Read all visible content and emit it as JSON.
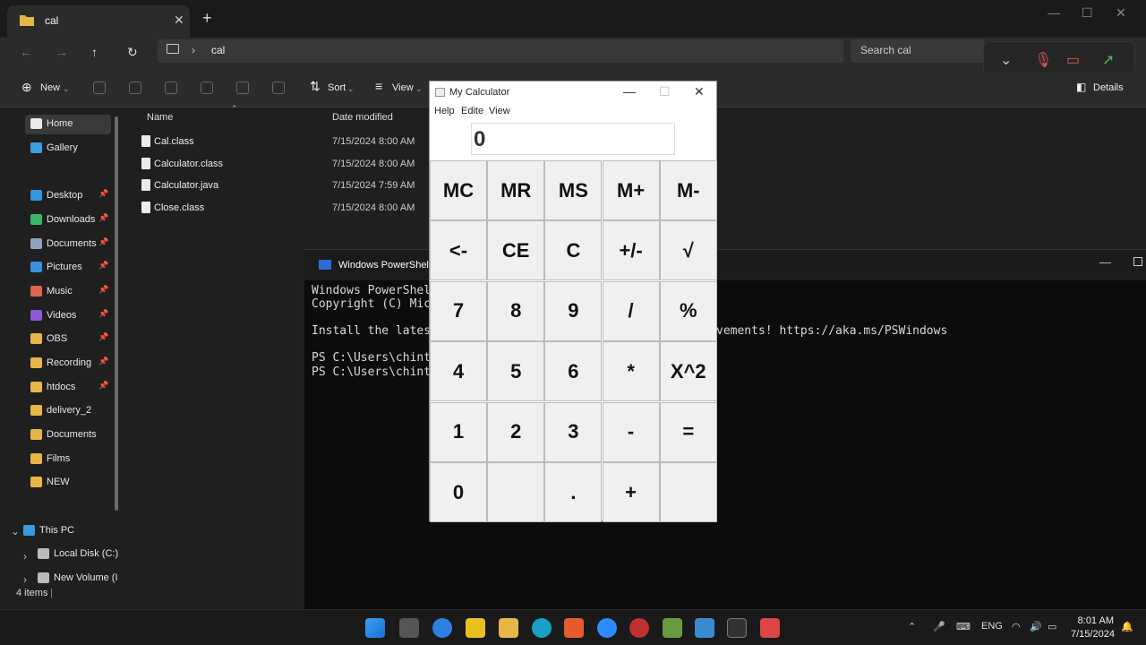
{
  "explorer": {
    "tab_title": "cal",
    "address_path": "cal",
    "search_placeholder": "Search cal",
    "toolbar": {
      "new_label": "New",
      "sort_label": "Sort",
      "view_label": "View",
      "details_label": "Details"
    },
    "columns": {
      "name": "Name",
      "date_modified": "Date modified"
    },
    "files": [
      {
        "name": "Cal.class",
        "date": "7/15/2024 8:00 AM"
      },
      {
        "name": "Calculator.class",
        "date": "7/15/2024 8:00 AM"
      },
      {
        "name": "Calculator.java",
        "date": "7/15/2024 7:59 AM"
      },
      {
        "name": "Close.class",
        "date": "7/15/2024 8:00 AM"
      }
    ],
    "sidebar": [
      {
        "label": "Home",
        "icon": "home-icon",
        "color": "#e9e9e9"
      },
      {
        "label": "Gallery",
        "icon": "gallery-icon",
        "color": "#3aa0e0"
      },
      {
        "label": "Desktop",
        "icon": "desktop-icon",
        "color": "#2f9ae0"
      },
      {
        "label": "Downloads",
        "icon": "download-icon",
        "color": "#39b56a"
      },
      {
        "label": "Documents",
        "icon": "documents-icon",
        "color": "#8fa3c0"
      },
      {
        "label": "Pictures",
        "icon": "pictures-icon",
        "color": "#3a8fdf"
      },
      {
        "label": "Music",
        "icon": "music-icon",
        "color": "#e0664a"
      },
      {
        "label": "Videos",
        "icon": "videos-icon",
        "color": "#8a5ad6"
      },
      {
        "label": "OBS",
        "icon": "folder-icon",
        "color": "#e8b646"
      },
      {
        "label": "Recording",
        "icon": "folder-icon",
        "color": "#e8b646"
      },
      {
        "label": "htdocs",
        "icon": "folder-icon",
        "color": "#e8b646"
      },
      {
        "label": "delivery_2",
        "icon": "folder-icon",
        "color": "#e8b646"
      },
      {
        "label": "Documents",
        "icon": "folder-icon",
        "color": "#e8b646"
      },
      {
        "label": "Films",
        "icon": "folder-icon",
        "color": "#e8b646"
      },
      {
        "label": "NEW",
        "icon": "folder-icon",
        "color": "#e8b646"
      },
      {
        "label": "This PC",
        "icon": "pc-icon",
        "color": "#3a9ae0"
      },
      {
        "label": "Local Disk (C:)",
        "icon": "disk-icon",
        "color": "#bbbbbb"
      },
      {
        "label": "New Volume (I",
        "icon": "disk-icon",
        "color": "#bbbbbb"
      }
    ],
    "status": "4 items"
  },
  "powershell": {
    "title": "Windows PowerShell",
    "lines": [
      "Windows PowerShel",
      "Copyright (C) Mic",
      "",
      "Install the lates",
      "",
      "PS C:\\Users\\chint",
      "PS C:\\Users\\chint"
    ],
    "tail_text": "vements! https://aka.ms/PSWindows"
  },
  "calculator": {
    "title": "My Calculator",
    "menu": [
      "Help",
      "Edite",
      "View"
    ],
    "display": "0",
    "keys": [
      [
        "MC",
        "MR",
        "MS",
        "M+",
        "M-"
      ],
      [
        "<-",
        "CE",
        "C",
        "+/-",
        "√"
      ],
      [
        "7",
        "8",
        "9",
        "/",
        "%"
      ],
      [
        "4",
        "5",
        "6",
        "*",
        "X^2"
      ],
      [
        "1",
        "2",
        "3",
        "-",
        "="
      ],
      [
        "0",
        "",
        ".",
        "+",
        ""
      ]
    ]
  },
  "taskbar": {
    "lang": "ENG",
    "time": "8:01 AM",
    "date": "7/15/2024"
  }
}
